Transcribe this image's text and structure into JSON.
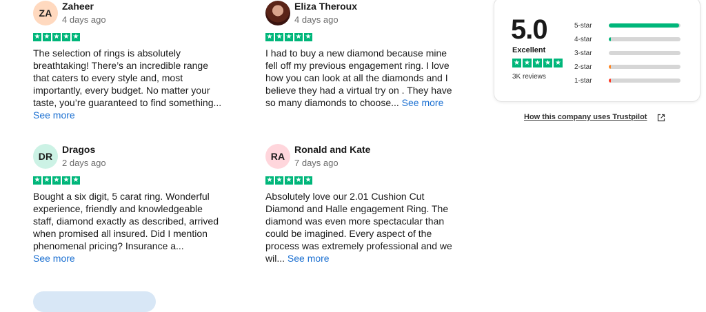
{
  "reviews": [
    {
      "initials": "ZA",
      "avatar_color": "#ffd9bf",
      "name": "Zaheer",
      "date": "4 days ago",
      "rating": 5,
      "text": "The selection of rings is absolutely breathtaking! There’s an incredible range that caters to every style and, most importantly, every budget. No matter your taste, you’re guaranteed to find something...",
      "see_more": "See more"
    },
    {
      "initials": "",
      "avatar_color": "",
      "name": "Eliza Theroux",
      "date": "4 days ago",
      "rating": 5,
      "text": "I had to buy a new diamond because mine fell off my previous engagement ring. I love how you can look at all the diamonds and I believe they had a virtual try on . They have so many diamonds to choose...",
      "see_more": "See more"
    },
    {
      "initials": "DR",
      "avatar_color": "#ccf2e5",
      "name": "Dragos",
      "date": "2 days ago",
      "rating": 5,
      "text": "Bought a six digit, 5 carat ring. Wonderful experience, friendly and knowledgeable staff, diamond exactly as described, arrived when promised all insured. Did I mention phenomenal pricing? Insurance a...",
      "see_more": "See more"
    },
    {
      "initials": "RA",
      "avatar_color": "#ffd6dc",
      "name": "Ronald and Kate",
      "date": "7 days ago",
      "rating": 5,
      "text": "Absolutely love our 2.01 Cushion Cut Diamond and Halle engagement Ring. The diamond was even more spectacular than could be imagined. Every aspect of the process was extremely professional and we wil...",
      "see_more": "See more"
    }
  ],
  "summary": {
    "score": "5.0",
    "label": "Excellent",
    "reviews_count": "3K reviews",
    "distribution": [
      {
        "label": "5-star",
        "fraction": 0.98,
        "color": "#00b67a"
      },
      {
        "label": "4-star",
        "fraction": 0.02,
        "color": "#00b67a"
      },
      {
        "label": "3-star",
        "fraction": 0.0,
        "color": "#d6d6d6"
      },
      {
        "label": "2-star",
        "fraction": 0.01,
        "color": "#ff8622"
      },
      {
        "label": "1-star",
        "fraction": 0.01,
        "color": "#ff3722"
      }
    ]
  },
  "trustpilot_link": "How this company uses Trustpilot",
  "star_color": "#00b67a",
  "link_color": "#1a6fd1"
}
